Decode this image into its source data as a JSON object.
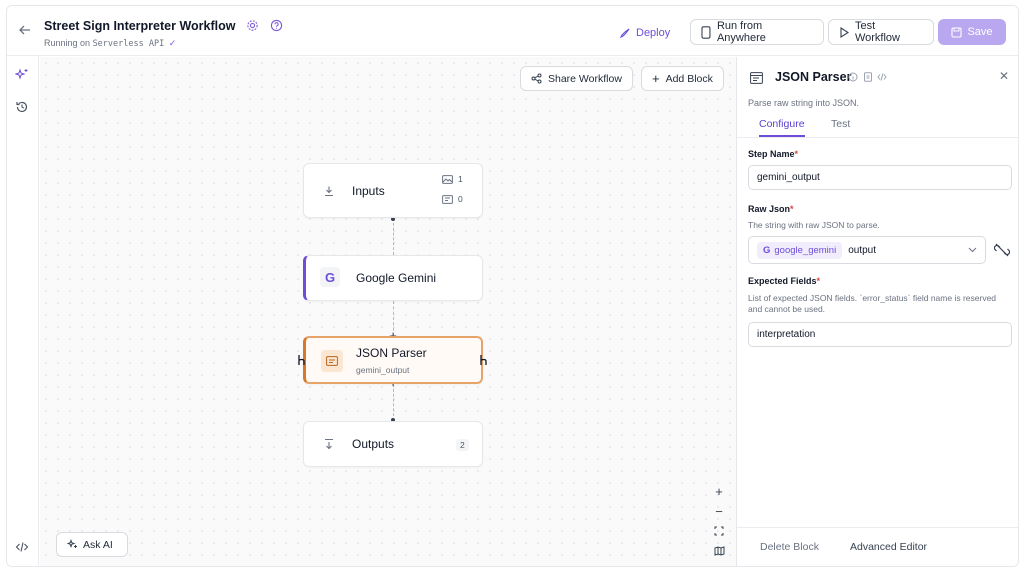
{
  "header": {
    "title": "Street Sign Interpreter Workflow",
    "subtitle_prefix": "Running on",
    "subtitle_env": "Serverless API",
    "deploy_label": "Deploy",
    "run_label": "Run from Anywhere",
    "test_label": "Test Workflow",
    "save_label": "Save"
  },
  "canvas": {
    "share_label": "Share Workflow",
    "add_label": "Add Block",
    "ask_ai_label": "Ask AI",
    "nodes": {
      "inputs": {
        "label": "Inputs",
        "image_count": "1",
        "param_count": "0"
      },
      "gemini": {
        "label": "Google Gemini"
      },
      "parser": {
        "label": "JSON Parser",
        "sub": "gemini_output"
      },
      "outputs": {
        "label": "Outputs",
        "count": "2"
      }
    }
  },
  "panel": {
    "title": "JSON Parser",
    "description": "Parse raw string into JSON.",
    "tabs": [
      "Configure",
      "Test"
    ],
    "step_name": {
      "label": "Step Name",
      "value": "gemini_output"
    },
    "raw_json": {
      "label": "Raw Json",
      "help": "The string with raw JSON to parse.",
      "source_chip": "google_gemini",
      "source_field": "output"
    },
    "expected_fields": {
      "label": "Expected Fields",
      "help": "List of expected JSON fields. `error_status` field name is reserved and cannot be used.",
      "value": "interpretation"
    },
    "footer": {
      "delete_label": "Delete Block",
      "advanced_label": "Advanced Editor"
    }
  },
  "colors": {
    "accent": "#6d4ed8",
    "parser_border": "#d9782a",
    "save_bg": "#b9a8ef"
  }
}
